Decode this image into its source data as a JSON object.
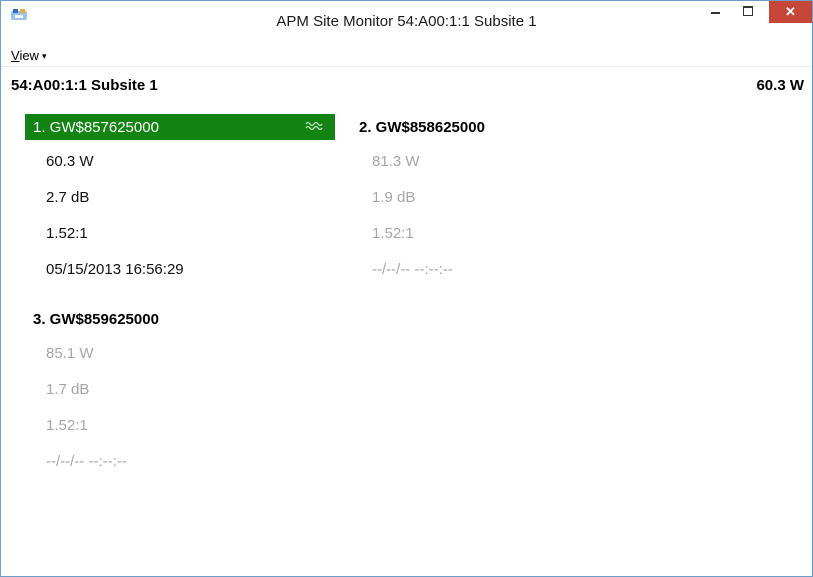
{
  "window": {
    "title": "APM Site Monitor 54:A00:1:1 Subsite 1",
    "close_label": "✕",
    "accent": "#c7463a"
  },
  "menu": {
    "view_label_first": "V",
    "view_label_rest": "iew",
    "caret": "▾"
  },
  "site": {
    "name": "54:A00:1:1 Subsite 1",
    "power": "60.3 W"
  },
  "channels": [
    {
      "title": "1. GW$857625000",
      "selected": true,
      "color": "#138313",
      "power": "60.3 W",
      "return_loss": "2.7 dB",
      "vswr": "1.52:1",
      "timestamp": "05/15/2013 16:56:29"
    },
    {
      "title": "2. GW$858625000",
      "selected": false,
      "power": "81.3 W",
      "return_loss": "1.9 dB",
      "vswr": "1.52:1",
      "timestamp": "--/--/-- --:--:--"
    },
    {
      "title": "3. GW$859625000",
      "selected": false,
      "power": "85.1 W",
      "return_loss": "1.7 dB",
      "vswr": "1.52:1",
      "timestamp": "--/--/-- --:--:--"
    }
  ]
}
